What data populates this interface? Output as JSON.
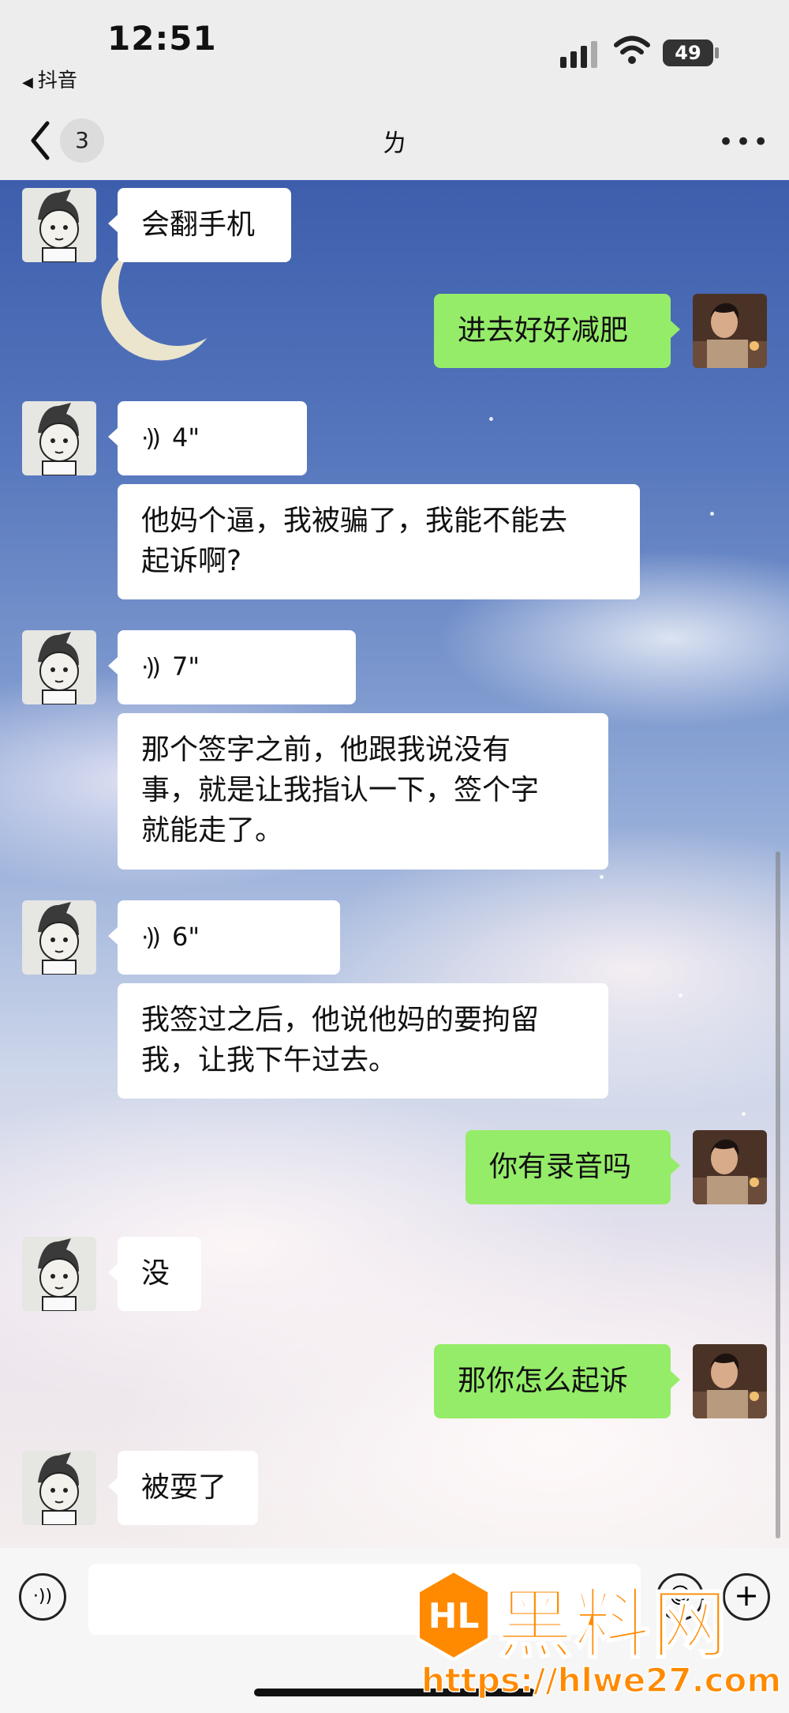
{
  "status_bar": {
    "time": "12:51",
    "back_app": "抖音",
    "battery": "49"
  },
  "nav": {
    "unread_count": "3",
    "title": "ㄌ",
    "more_label": "•••"
  },
  "messages": [
    {
      "side": "left",
      "type": "text",
      "text": "会翻手机"
    },
    {
      "side": "right",
      "type": "text",
      "text": "进去好好减肥"
    },
    {
      "side": "left",
      "type": "voice",
      "duration": "4\""
    },
    {
      "side": "left",
      "type": "text",
      "text": "他妈个逼，我被骗了，我能不能去\n起诉啊?"
    },
    {
      "side": "left",
      "type": "voice",
      "duration": "7\""
    },
    {
      "side": "left",
      "type": "text",
      "text": "那个签字之前，他跟我说没有\n事，就是让我指认一下，签个字\n就能走了。"
    },
    {
      "side": "left",
      "type": "voice",
      "duration": "6\""
    },
    {
      "side": "left",
      "type": "text",
      "text": "我签过之后，他说他妈的要拘留\n我，让我下午过去。"
    },
    {
      "side": "right",
      "type": "text",
      "text": "你有录音吗"
    },
    {
      "side": "left",
      "type": "text",
      "text": "没"
    },
    {
      "side": "right",
      "type": "text",
      "text": "那你怎么起诉"
    },
    {
      "side": "left",
      "type": "text",
      "text": "被耍了"
    }
  ],
  "input_bar": {
    "voice_icon": "voice-mode-icon",
    "emoji_icon": "emoji-icon",
    "plus_icon": "plus-icon"
  },
  "watermark": {
    "title": "黑料网",
    "url": "https://hlwe27.com"
  },
  "colors": {
    "sent_bubble": "#95ec69",
    "received_bubble": "#ffffff",
    "watermark": "#ff8a00"
  }
}
